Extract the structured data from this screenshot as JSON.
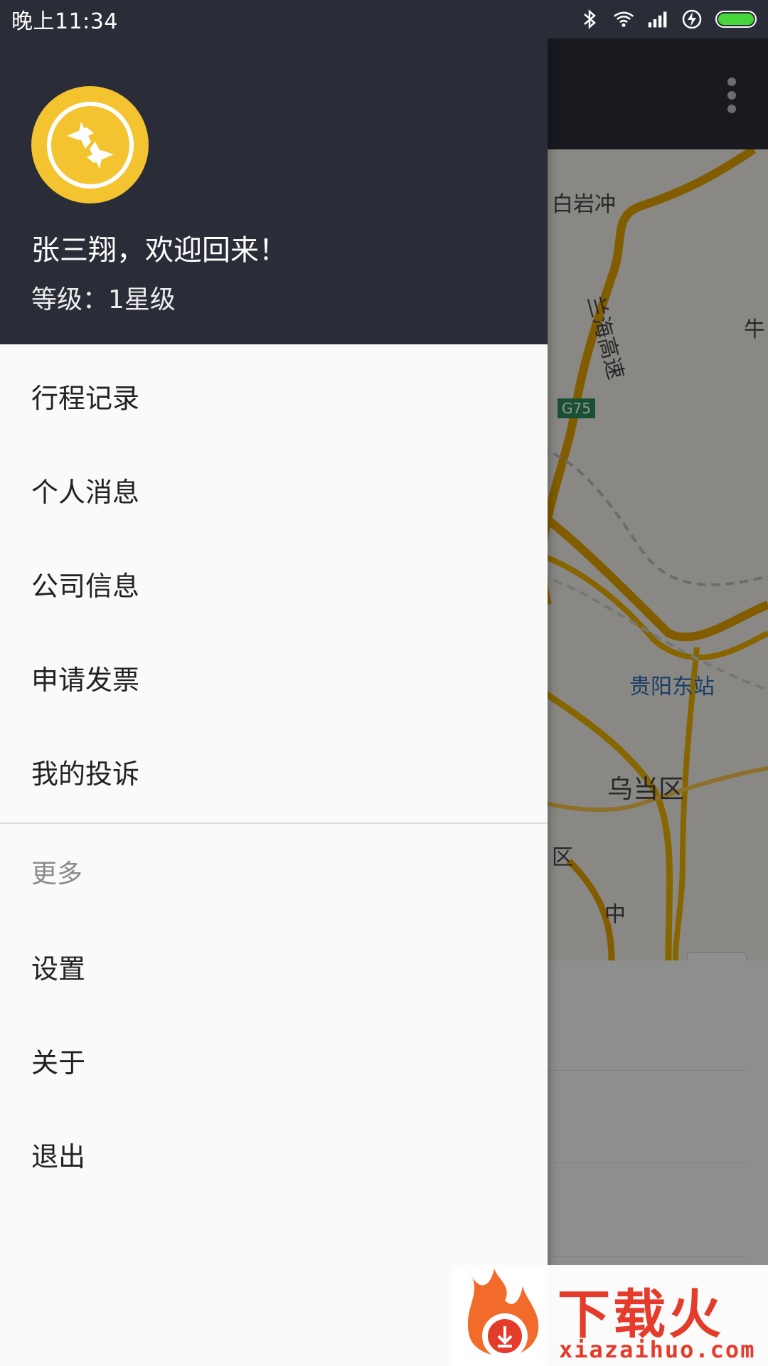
{
  "status_bar": {
    "time": "晚上11:34"
  },
  "drawer": {
    "user_name": "张三翔，欢迎回来！",
    "user_level": "等级：1星级",
    "menu_items": [
      {
        "label": "行程记录"
      },
      {
        "label": "个人消息"
      },
      {
        "label": "公司信息"
      },
      {
        "label": "申请发票"
      },
      {
        "label": "我的投诉"
      }
    ],
    "more_header": "更多",
    "more_items": [
      {
        "label": "设置"
      },
      {
        "label": "关于"
      },
      {
        "label": "退出"
      }
    ]
  },
  "map": {
    "labels": {
      "baiyanchong": "白岩冲",
      "lanhai": "兰海高速",
      "road_sign": "G75",
      "guiyang_east": "贵阳东站",
      "wudang": "乌当区",
      "qu": "区",
      "niu": "牛",
      "zhong": "中"
    }
  },
  "watermark": {
    "text": "下载火",
    "url": "xiazaihuo.com"
  },
  "colors": {
    "header_bg": "#2a2d37",
    "avatar_bg": "#f4c430",
    "battery": "#47d63a",
    "watermark": "#e53b2a"
  }
}
